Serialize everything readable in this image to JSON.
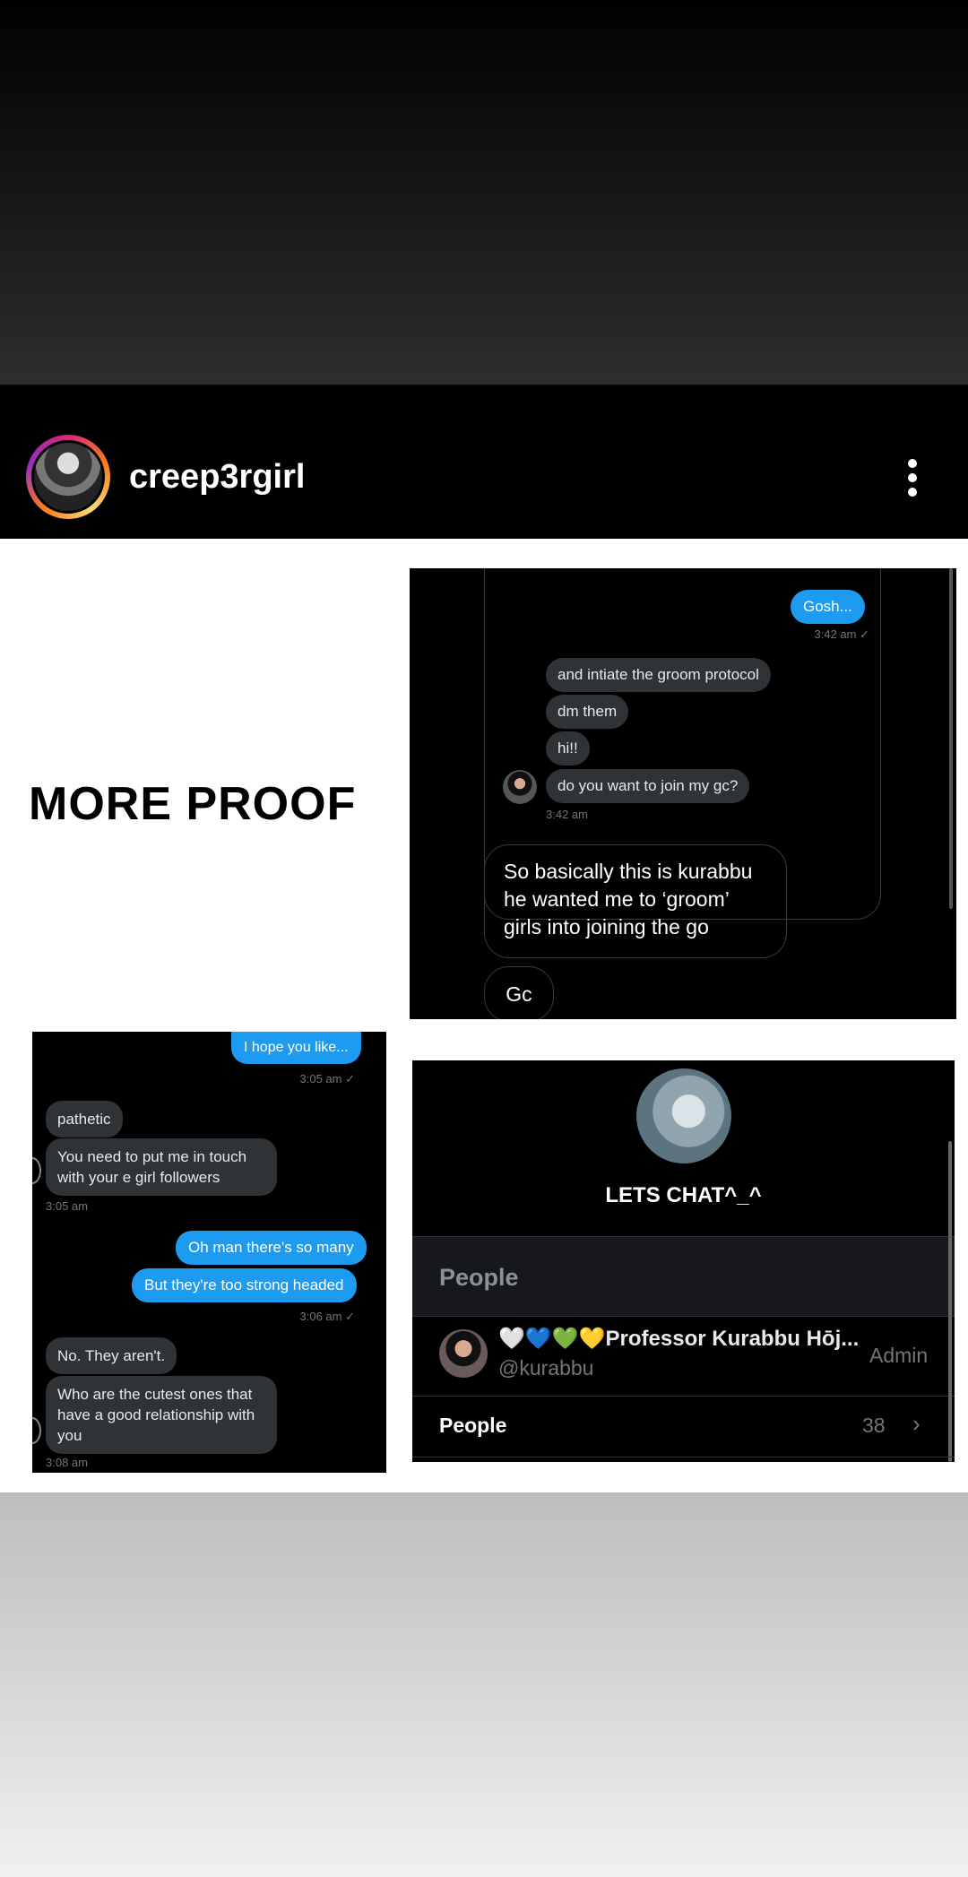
{
  "profile": {
    "username": "creep3rgirl"
  },
  "headline": "MORE PROOF",
  "screenshot_1": {
    "gosh": "Gosh...",
    "gosh_time": "3:42 am ✓",
    "messages": [
      "and intiate the groom protocol",
      "dm them",
      "hi!!",
      "do you want to join my gc?"
    ],
    "messages_time": "3:42 am",
    "note": "So basically this is kurabbu he wanted me to ‘groom’ girls into joining the go",
    "gc": "Gc"
  },
  "screenshot_2": {
    "hope": "I hope you like...",
    "time1": "3:05 am ✓",
    "pathetic": "pathetic",
    "touch": "You need to put me in touch with your e girl followers",
    "time2": "3:05 am",
    "so_many": "Oh man there's so many",
    "strong": "But they're too strong headed",
    "time3": "3:06 am ✓",
    "arent": "No. They aren't.",
    "cutest": "Who are the cutest ones that have a good relationship with you",
    "time4": "3:08 am"
  },
  "screenshot_3": {
    "group_name": "LETS CHAT^_^",
    "section_header": "People",
    "member": {
      "name": "🤍💙💚💛Professor Kurabbu Hōj...",
      "handle": "@kurabbu",
      "role": "Admin"
    },
    "people_label": "People",
    "people_count": "38",
    "chevron": "›"
  },
  "colors": {
    "accent_blue": "#1d9bf0",
    "bubble_gray": "#2f3336"
  },
  "icons": {
    "more": "more-vertical-icon",
    "chevron": "chevron-right-icon"
  }
}
